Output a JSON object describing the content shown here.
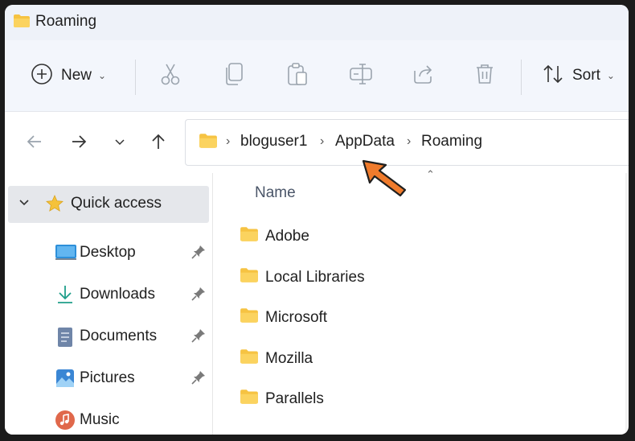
{
  "window": {
    "title": "Roaming"
  },
  "toolbar": {
    "new_label": "New",
    "sort_label": "Sort",
    "icons": [
      "cut-icon",
      "copy-icon",
      "paste-icon",
      "rename-icon",
      "share-icon",
      "delete-icon"
    ]
  },
  "address": {
    "crumbs": [
      "bloguser1",
      "AppData",
      "Roaming"
    ]
  },
  "sidebar": {
    "quick_access": "Quick access",
    "items": [
      {
        "label": "Desktop",
        "icon": "desktop-icon",
        "pinned": true
      },
      {
        "label": "Downloads",
        "icon": "download-icon",
        "pinned": true
      },
      {
        "label": "Documents",
        "icon": "documents-icon",
        "pinned": true
      },
      {
        "label": "Pictures",
        "icon": "pictures-icon",
        "pinned": true
      },
      {
        "label": "Music",
        "icon": "music-icon",
        "pinned": false
      }
    ]
  },
  "content": {
    "column_header": "Name",
    "rows": [
      "Adobe",
      "Local Libraries",
      "Microsoft",
      "Mozilla",
      "Parallels"
    ]
  },
  "colors": {
    "accent": "#f07b2c",
    "folder": "#f6c342",
    "selection": "#e5e7eb"
  }
}
